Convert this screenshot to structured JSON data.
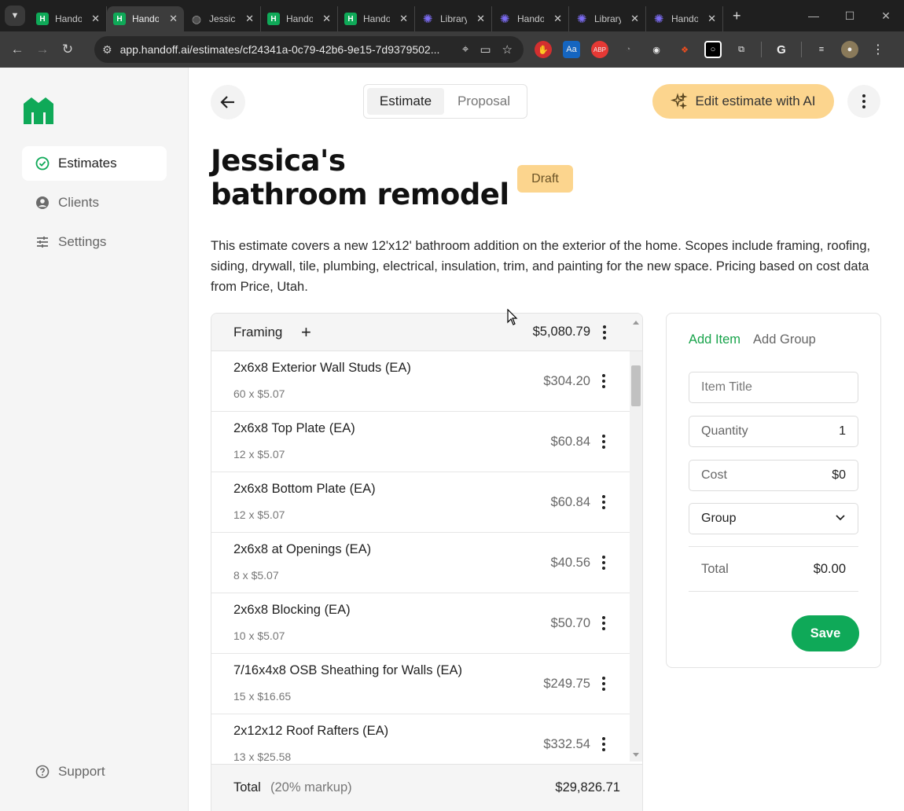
{
  "browser": {
    "tabs": [
      {
        "label": "Handoff",
        "favicon": "handoff",
        "active": false
      },
      {
        "label": "Handoff",
        "favicon": "handoff",
        "active": true
      },
      {
        "label": "Jessica",
        "favicon": "globe",
        "active": false
      },
      {
        "label": "Handoff",
        "favicon": "handoff",
        "active": false
      },
      {
        "label": "Handoff",
        "favicon": "handoff",
        "active": false
      },
      {
        "label": "Library",
        "favicon": "star",
        "active": false
      },
      {
        "label": "Handoff",
        "favicon": "star",
        "active": false
      },
      {
        "label": "Library",
        "favicon": "star",
        "active": false
      },
      {
        "label": "Handoff",
        "favicon": "star",
        "active": false
      }
    ],
    "url": "app.handoff.ai/estimates/cf24341a-0c79-42b6-9e15-7d9379502..."
  },
  "sidebar": {
    "items": [
      {
        "label": "Estimates",
        "icon": "check-circle-icon"
      },
      {
        "label": "Clients",
        "icon": "user-circle-icon"
      },
      {
        "label": "Settings",
        "icon": "sliders-icon"
      }
    ],
    "support": "Support"
  },
  "header": {
    "segments": [
      "Estimate",
      "Proposal"
    ],
    "ai_button": "Edit estimate with AI"
  },
  "estimate": {
    "title": "Jessica's bathroom remodel",
    "status": "Draft",
    "description": "This estimate covers a new 12'x12' bathroom addition on the exterior of the home. Scopes include framing, roofing, siding, drywall, tile, plumbing, electrical, insulation, trim, and painting for the new space. Pricing based on cost data from Price, Utah."
  },
  "group": {
    "name": "Framing",
    "add": "+",
    "amount": "$5,080.79"
  },
  "line_items": [
    {
      "name": "2x6x8 Exterior Wall Studs (EA)",
      "detail": "60 x $5.07",
      "amount": "$304.20"
    },
    {
      "name": "2x6x8 Top Plate (EA)",
      "detail": "12 x $5.07",
      "amount": "$60.84"
    },
    {
      "name": "2x6x8 Bottom Plate (EA)",
      "detail": "12 x $5.07",
      "amount": "$60.84"
    },
    {
      "name": "2x6x8 at Openings (EA)",
      "detail": "8 x $5.07",
      "amount": "$40.56"
    },
    {
      "name": "2x6x8 Blocking (EA)",
      "detail": "10 x $5.07",
      "amount": "$50.70"
    },
    {
      "name": "7/16x4x8 OSB Sheathing for Walls (EA)",
      "detail": "15 x $16.65",
      "amount": "$249.75"
    },
    {
      "name": "2x12x12 Roof Rafters (EA)",
      "detail": "13 x $25.58",
      "amount": "$332.54"
    }
  ],
  "totals": {
    "label": "Total",
    "markup": "(20% markup)",
    "amount": "$29,826.71"
  },
  "form": {
    "tab_add_item": "Add Item",
    "tab_add_group": "Add Group",
    "item_title_placeholder": "Item Title",
    "quantity_label": "Quantity",
    "quantity_value": "1",
    "cost_label": "Cost",
    "cost_value": "$0",
    "group_label": "Group",
    "total_label": "Total",
    "total_value": "$0.00",
    "save": "Save"
  },
  "colors": {
    "brand": "#0fa958",
    "accent": "#fcd58e"
  }
}
